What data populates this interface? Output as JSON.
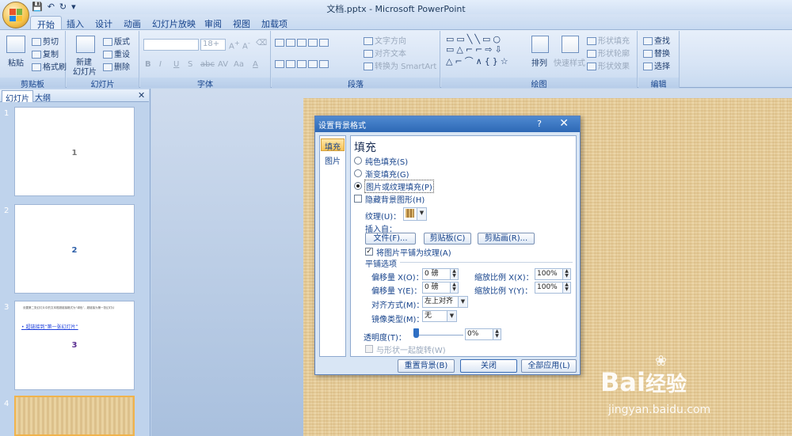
{
  "window": {
    "title": "文档.pptx - Microsoft PowerPoint"
  },
  "tabs": [
    "开始",
    "插入",
    "设计",
    "动画",
    "幻灯片放映",
    "审阅",
    "视图",
    "加载项"
  ],
  "ribbon": {
    "clipboard": {
      "label": "剪贴板",
      "paste": "粘贴",
      "cut": "剪切",
      "copy": "复制",
      "format_painter": "格式刷"
    },
    "slides": {
      "label": "幻灯片",
      "new_slide_1": "新建",
      "new_slide_2": "幻灯片",
      "layout": "版式",
      "reset": "重设",
      "delete": "删除"
    },
    "font": {
      "label": "字体",
      "size": "18+",
      "bold": "B",
      "italic": "I",
      "underline": "U",
      "strike": "S",
      "abc": "abc",
      "shadow": "S",
      "spacing": "AV",
      "case": "Aa",
      "color": "A"
    },
    "paragraph": {
      "label": "段落",
      "text_direction": "文字方向",
      "align_text": "对齐文本",
      "smartart": "转换为 SmartArt"
    },
    "drawing": {
      "label": "绘图",
      "arrange": "排列",
      "quick_styles": "快速样式",
      "shape_fill": "形状填充",
      "shape_outline": "形状轮廓",
      "shape_effects": "形状效果"
    },
    "editing": {
      "label": "编辑",
      "find": "查找",
      "replace": "替换",
      "select": "选择"
    }
  },
  "left_pane": {
    "tabs": [
      "幻灯片",
      "大纲"
    ],
    "slides": [
      {
        "num": "1",
        "content": "1"
      },
      {
        "num": "2",
        "content": "2"
      },
      {
        "num": "3",
        "content": "3",
        "note": "设置第二张幻灯片中的文本框超链接格式为“绿色”，超链接为第一张幻灯片",
        "link": "超链接到“第一张幻灯片”"
      },
      {
        "num": "4",
        "content": ""
      }
    ]
  },
  "dialog": {
    "title": "设置背景格式",
    "help": "?",
    "close": "✕",
    "nav": [
      "填充",
      "图片"
    ],
    "heading": "填充",
    "options": {
      "solid": "纯色填充(S)",
      "gradient": "渐变填充(G)",
      "picture": "图片或纹理填充(P)",
      "hide_graphics": "隐藏背景图形(H)"
    },
    "texture_label": "纹理(U)：",
    "insert_from": "插入自：",
    "file_btn": "文件(F)...",
    "clipboard_btn": "剪贴板(C)",
    "clipart_btn": "剪贴画(R)...",
    "tile_check": "将图片平铺为纹理(A)",
    "tile_options": "平铺选项",
    "offset_x_label": "偏移量 X(O)：",
    "offset_x": "0 磅",
    "offset_y_label": "偏移量 Y(E)：",
    "offset_y": "0 磅",
    "scale_x_label": "缩放比例 X(X)：",
    "scale_x": "100%",
    "scale_y_label": "缩放比例 Y(Y)：",
    "scale_y": "100%",
    "alignment_label": "对齐方式(M)：",
    "alignment": "左上对齐",
    "mirror_label": "镜像类型(M)：",
    "mirror": "无",
    "transparency_label": "透明度(T)：",
    "transparency": "0%",
    "rotate_with_shape": "与形状一起旋转(W)",
    "reset_btn": "重置背景(B)",
    "close_btn": "关闭",
    "apply_all_btn": "全部应用(L)"
  },
  "watermark": {
    "brand": "Bai",
    "brand2": "经验",
    "url": "jingyan.baidu.com"
  }
}
